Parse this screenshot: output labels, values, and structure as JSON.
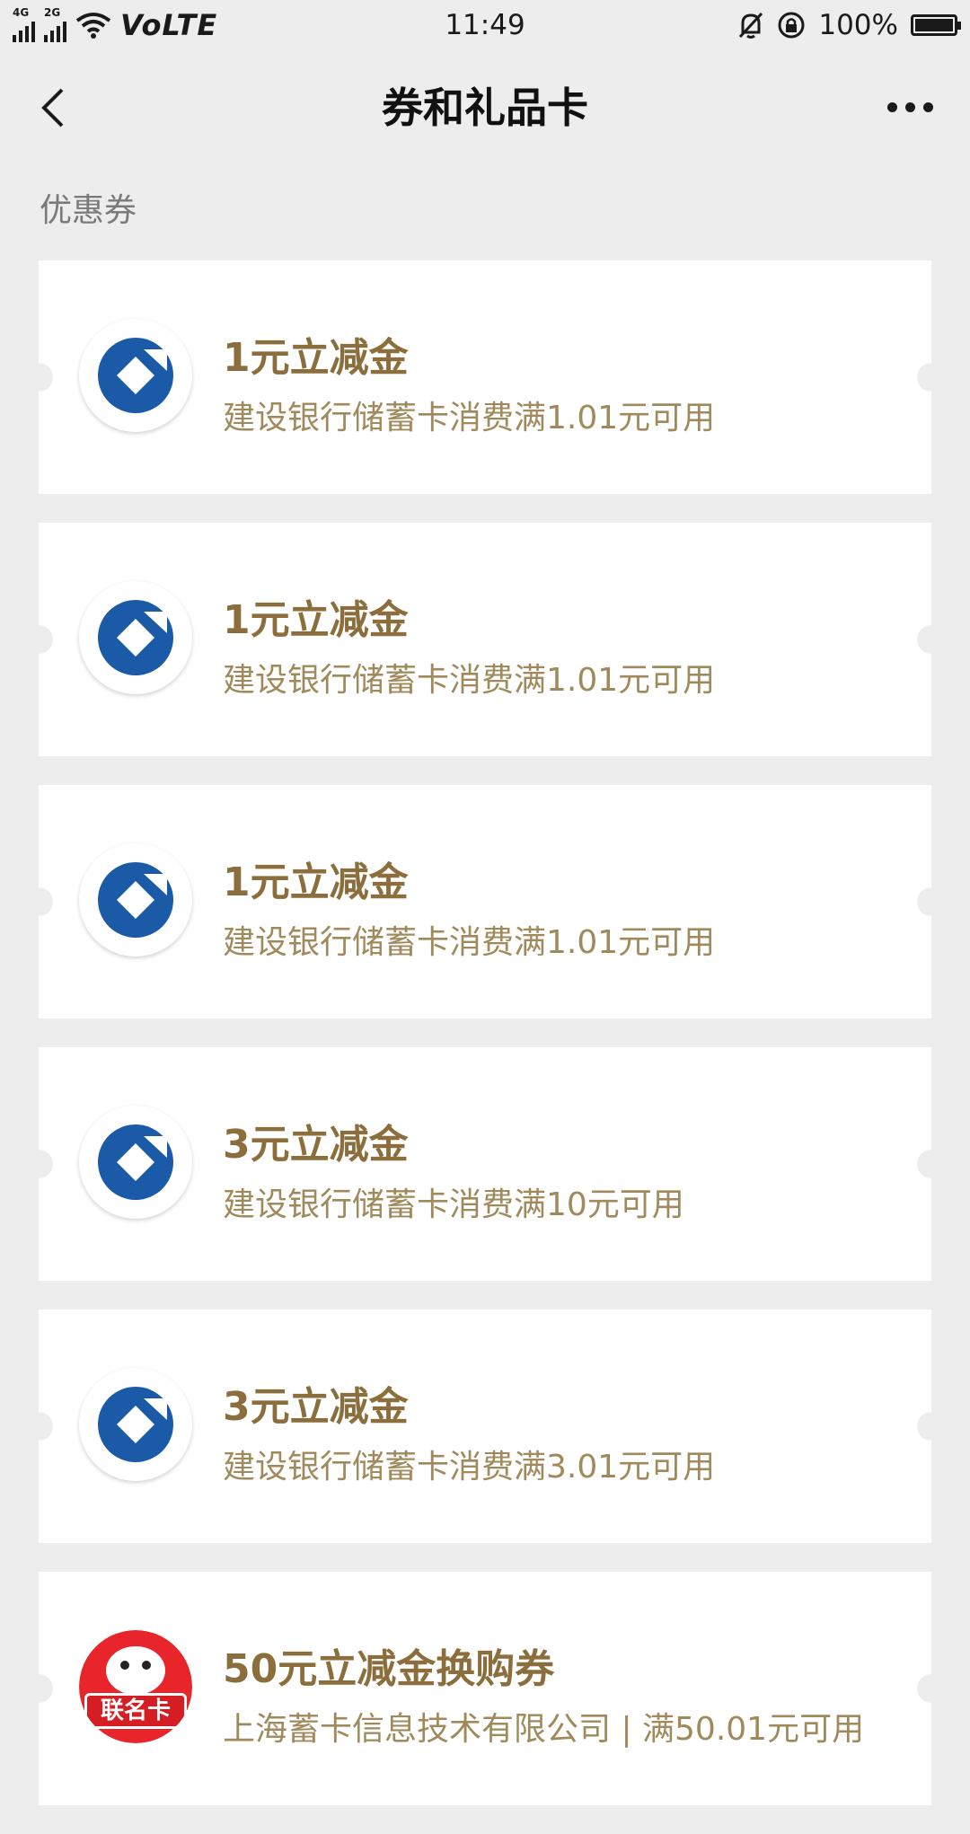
{
  "status_bar": {
    "network_1": "4G",
    "network_2": "2G",
    "volte": "VoLTE",
    "time": "11:49",
    "battery_percent": "100%",
    "icons": [
      "signal-icon",
      "signal-icon",
      "wifi-icon",
      "mute-icon",
      "rotation-lock-icon",
      "battery-icon"
    ]
  },
  "nav": {
    "title": "券和礼品卡",
    "back_icon": "chevron-left-icon",
    "more_icon": "more-dots-icon"
  },
  "section": {
    "title": "优惠券"
  },
  "coupons": [
    {
      "title": "1元立减金",
      "desc": "建设银行储蓄卡消费满1.01元可用",
      "logo": "ccb-logo"
    },
    {
      "title": "1元立减金",
      "desc": "建设银行储蓄卡消费满1.01元可用",
      "logo": "ccb-logo"
    },
    {
      "title": "1元立减金",
      "desc": "建设银行储蓄卡消费满1.01元可用",
      "logo": "ccb-logo"
    },
    {
      "title": "3元立减金",
      "desc": "建设银行储蓄卡消费满10元可用",
      "logo": "ccb-logo"
    },
    {
      "title": "3元立减金",
      "desc": "建设银行储蓄卡消费满3.01元可用",
      "logo": "ccb-logo"
    },
    {
      "title": "50元立减金换购券",
      "desc": "上海蓄卡信息技术有限公司 | 满50.01元可用",
      "logo": "jd-lianmingka-logo",
      "logo_text": "联名卡"
    }
  ],
  "colors": {
    "background": "#ededed",
    "coupon_title": "#8b6e3c",
    "coupon_desc": "#a08a5c",
    "ccb_blue": "#1a5aa6",
    "jd_red": "#e8252b"
  }
}
